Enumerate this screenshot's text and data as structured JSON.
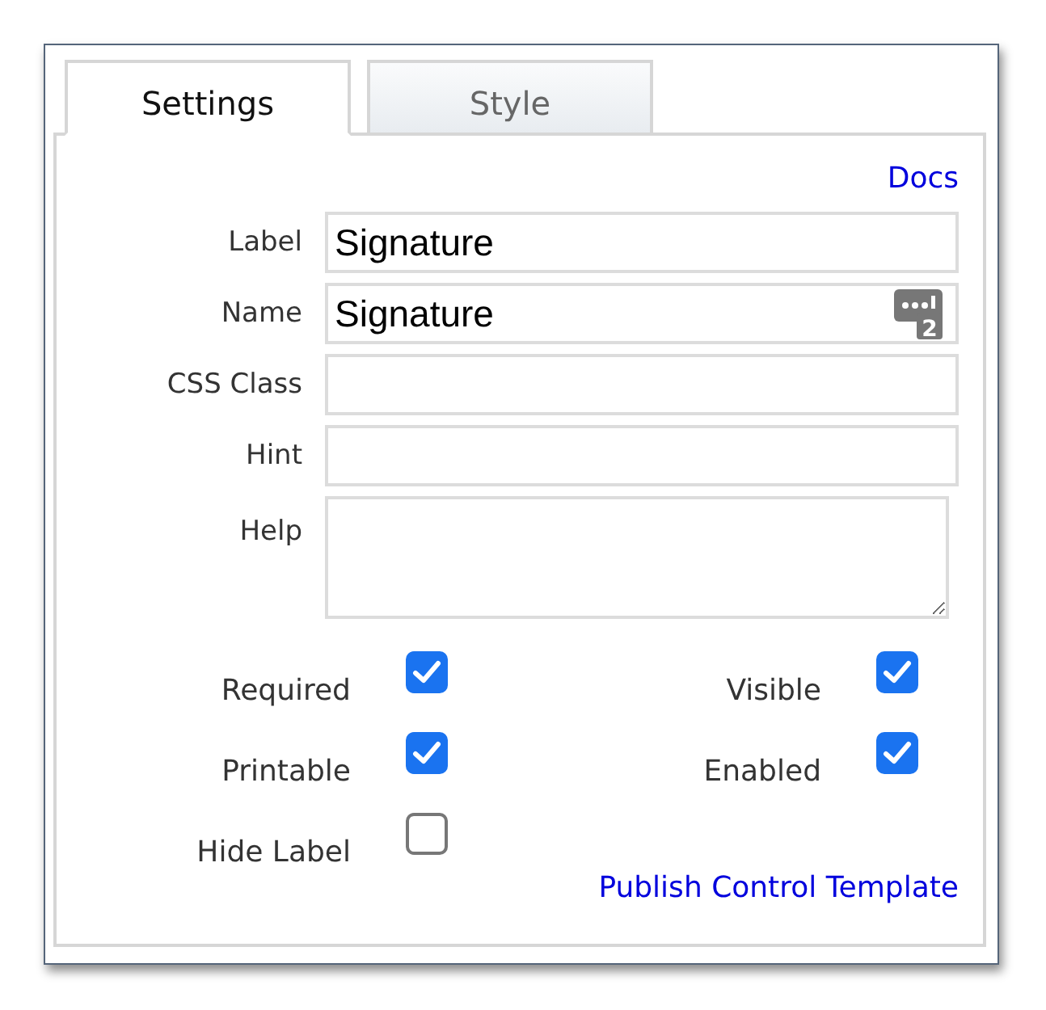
{
  "tabs": [
    {
      "label": "Settings",
      "selected": true
    },
    {
      "label": "Style",
      "selected": false
    }
  ],
  "docs_link": "Docs",
  "fields": [
    {
      "label": "Label",
      "kind": "text",
      "value": "Signature"
    },
    {
      "label": "Name",
      "kind": "text-count",
      "value": "Signature",
      "count": "2"
    },
    {
      "label": "CSS Class",
      "kind": "text"
    },
    {
      "label": "Hint",
      "kind": "text"
    },
    {
      "label": "Help",
      "kind": "textarea"
    }
  ],
  "checkboxes": [
    {
      "label": "Required",
      "checked": true
    },
    {
      "label": "Visible",
      "checked": true
    },
    {
      "label": "Printable",
      "checked": true
    },
    {
      "label": "Enabled",
      "checked": true
    },
    {
      "label": "Hide Label",
      "checked": false
    }
  ],
  "publish_link": "Publish Control Template"
}
